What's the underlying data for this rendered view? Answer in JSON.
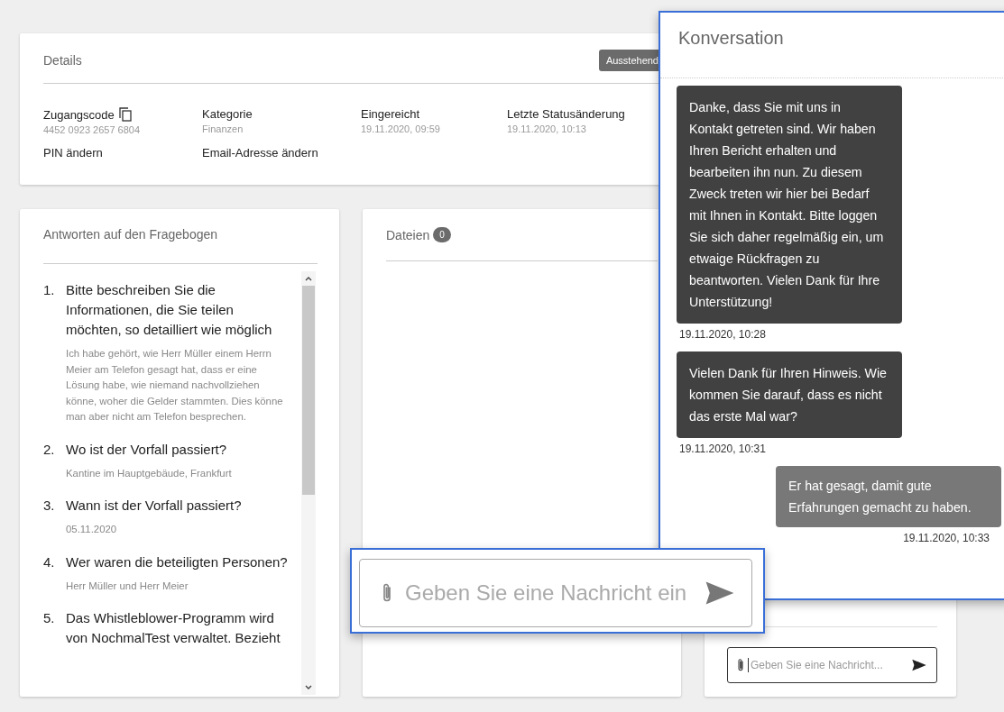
{
  "details": {
    "title": "Details",
    "status_badge": "Ausstehend",
    "fields": [
      {
        "label": "Zugangscode",
        "value": "4452 0923 2657 6804",
        "copyable": true
      },
      {
        "label": "Kategorie",
        "value": "Finanzen",
        "copyable": false
      },
      {
        "label": "Eingereicht",
        "value": "19.11.2020, 09:59",
        "copyable": false
      },
      {
        "label": "Letzte Statusänderung",
        "value": "19.11.2020, 10:13",
        "copyable": false
      }
    ],
    "links": [
      "PIN ändern",
      "Email-Adresse ändern"
    ]
  },
  "questionnaire": {
    "title": "Antworten auf den Fragebogen",
    "items": [
      {
        "number": "1.",
        "question": "Bitte beschreiben Sie die Informationen, die Sie teilen möchten, so detailliert wie möglich",
        "answer": "Ich habe gehört, wie Herr Müller einem Herrn Meier am Telefon gesagt hat, dass er eine Lösung habe, wie niemand nachvollziehen könne, woher die Gelder stammten. Dies könne man aber nicht am Telefon besprechen."
      },
      {
        "number": "2.",
        "question": "Wo ist der Vorfall passiert?",
        "answer": "Kantine im Hauptgebäude, Frankfurt"
      },
      {
        "number": "3.",
        "question": "Wann ist der Vorfall passiert?",
        "answer": "05.11.2020"
      },
      {
        "number": "4.",
        "question": "Wer waren die beteiligten Personen?",
        "answer": "Herr Müller und Herr Meier"
      },
      {
        "number": "5.",
        "question": "Das Whistleblower-Programm wird von NochmalTest verwaltet. Bezieht"
      }
    ]
  },
  "files": {
    "title": "Dateien",
    "count": "0"
  },
  "chat_panel": {
    "placeholder": "Geben Sie eine Nachricht..."
  },
  "conversation_callout": {
    "title": "Konversation",
    "messages": [
      {
        "kind": "received",
        "text": "Danke, dass Sie mit uns in Kontakt getreten sind. Wir haben Ihren Bericht erhalten und bearbeiten ihn nun. Zu diesem Zweck treten wir hier bei Bedarf mit Ihnen in Kontakt. Bitte loggen Sie sich daher regelmäßig ein, um etwaige Rückfragen zu beantworten. Vielen Dank für Ihre Unterstützung!",
        "time": "19.11.2020, 10:28"
      },
      {
        "kind": "received",
        "text": "Vielen Dank für Ihren Hinweis. Wie kommen Sie darauf, dass es nicht das erste Mal war?",
        "time": "19.11.2020, 10:31"
      },
      {
        "kind": "sent",
        "text": "Er hat gesagt, damit gute Erfahrungen gemacht zu haben.",
        "time": "19.11.2020, 10:33"
      }
    ]
  },
  "input_callout": {
    "placeholder": "Geben Sie eine Nachricht ein"
  }
}
